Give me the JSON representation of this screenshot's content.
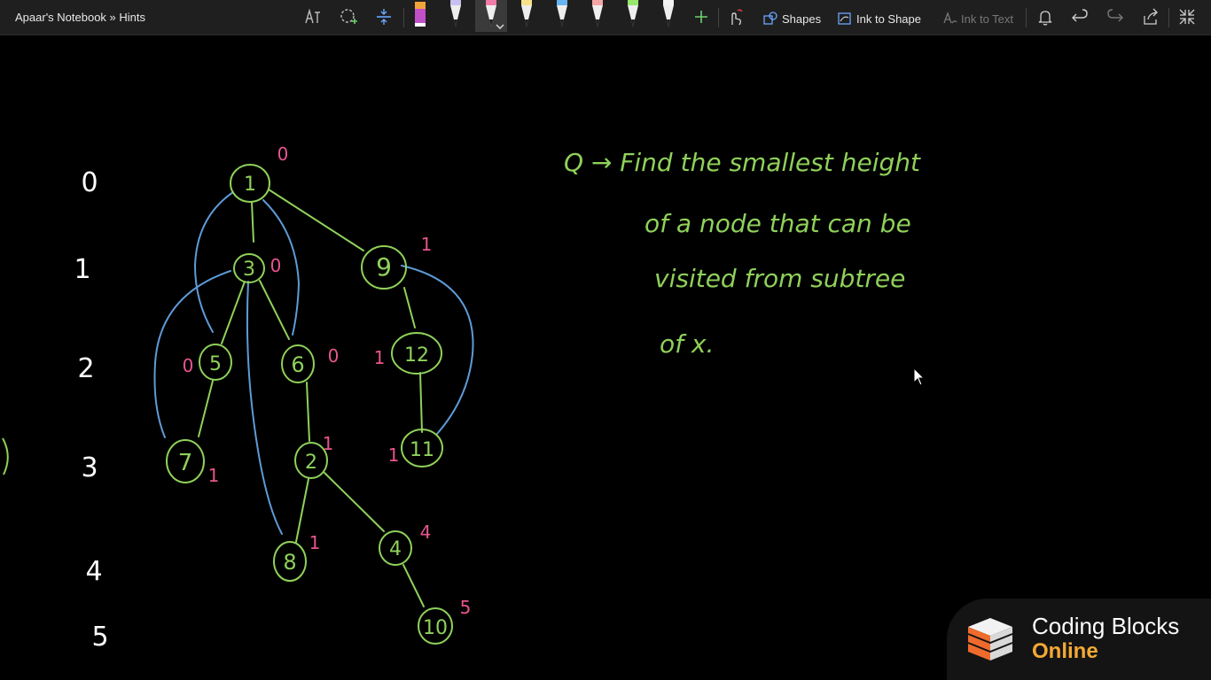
{
  "window": {
    "title": "Apaar's Notebook » Hints"
  },
  "toolbar": {
    "pen_colors": [
      "#c050c8",
      "#c8c0f0",
      "#f07aa8",
      "#f6e28a",
      "#68b4f0",
      "#f4a6a6",
      "#98e66c",
      "#f2f2f2"
    ],
    "selected_pen_index": 2,
    "shapes_label": "Shapes",
    "ink_to_shape_label": "Ink to Shape",
    "ink_to_text_label": "Ink to Text"
  },
  "canvas": {
    "level_labels": [
      "0",
      "1",
      "2",
      "3",
      "4",
      "5"
    ],
    "nodes": [
      "1",
      "3",
      "9",
      "5",
      "6",
      "12",
      "7",
      "2",
      "11",
      "8",
      "4",
      "10"
    ],
    "node_annotations": [
      "0",
      "0",
      "1",
      "0",
      "0",
      "1",
      "1",
      "1",
      "1",
      "1",
      "4",
      "5"
    ],
    "question_lines": [
      "Q → Find the smallest height",
      "of a node that can be",
      "visited from subtree",
      "of x."
    ],
    "colors": {
      "green_ink": "#8fd15a",
      "blue_ink": "#5e9bd8",
      "pink_ink": "#e8558e",
      "level_ink": "#ffffff"
    }
  },
  "watermark": {
    "line1": "Coding Blocks",
    "line2": "Online"
  }
}
